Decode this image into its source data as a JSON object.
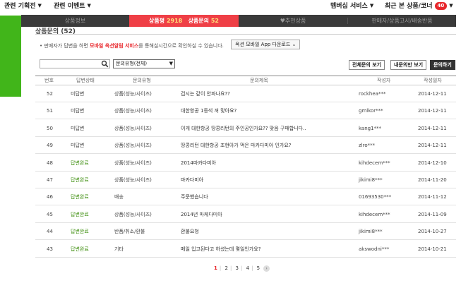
{
  "topnav": {
    "left1": "관련 기획전",
    "left2": "관련 이벤트",
    "right1": "멤버십 서비스",
    "right2": "최근 본 상품/코너",
    "recent_count": "40"
  },
  "tabs": [
    {
      "label": "상품정보"
    },
    {
      "label_review": "상품평",
      "review_count": "2918",
      "label_inquiry": "상품문의",
      "inquiry_count": "52"
    },
    {
      "label": "♥추천상품"
    },
    {
      "label": "판매자/상품고시/배송반품"
    }
  ],
  "section": {
    "title": "상품문의 (52)"
  },
  "notice": {
    "pre": "• 판매자가 답변을 하면 ",
    "highlight": "모바일 옥션알림 서비스",
    "post": "를 통해실시간으로 확인하실 수 있습니다."
  },
  "download_button": "옥션 모바일 App 다운로드",
  "filter": {
    "search_value": "",
    "select_value": "문의유형(전체)"
  },
  "buttons": {
    "all": "전체문의 보기",
    "mine": "내문의만 보기",
    "ask": "문의하기"
  },
  "columns": {
    "no": "번호",
    "status": "답변상태",
    "type": "문의유형",
    "title": "문의제목",
    "author": "작성자",
    "date": "작성일자"
  },
  "rows": [
    {
      "no": "52",
      "status": "미답변",
      "done": false,
      "type": "상품(성능/사이즈)",
      "title": "겁시는 같이 안파나요??",
      "author": "rockhea***",
      "date": "2014-12-11"
    },
    {
      "no": "51",
      "status": "미답변",
      "done": false,
      "type": "상품(성능/사이즈)",
      "title": "대한항공 1등석 꺼 맞아요?",
      "author": "gmlkor***",
      "date": "2014-12-11"
    },
    {
      "no": "50",
      "status": "미답변",
      "done": false,
      "type": "상품(성능/사이즈)",
      "title": "이게 대한항공 땅콩리턴의 주인공인가요?? 맞음 구매합니다..",
      "author": "kang1***",
      "date": "2014-12-11"
    },
    {
      "no": "49",
      "status": "미답변",
      "done": false,
      "type": "상품(성능/사이즈)",
      "title": "땅콩리턴 대한항공 조현아가 먹은 마카다미아 인가요?",
      "author": "zlro***",
      "date": "2014-12-11"
    },
    {
      "no": "48",
      "status": "답변완료",
      "done": true,
      "type": "상품(성능/사이즈)",
      "title": "2014마카다미아",
      "author": "kihdecem***",
      "date": "2014-12-10"
    },
    {
      "no": "47",
      "status": "답변완료",
      "done": true,
      "type": "상품(성능/사이즈)",
      "title": "마카다미아",
      "author": "jikimi8***",
      "date": "2014-11-20"
    },
    {
      "no": "46",
      "status": "답변완료",
      "done": true,
      "type": "배송",
      "title": "주문했습니다",
      "author": "01693530***",
      "date": "2014-11-12"
    },
    {
      "no": "45",
      "status": "답변완료",
      "done": true,
      "type": "상품(성능/사이즈)",
      "title": "2014년 마케다미아",
      "author": "kihdecem***",
      "date": "2014-11-09"
    },
    {
      "no": "44",
      "status": "답변완료",
      "done": true,
      "type": "반품/취소/환불",
      "title": "환불요청",
      "author": "jikimi8***",
      "date": "2014-10-27"
    },
    {
      "no": "43",
      "status": "답변완료",
      "done": true,
      "type": "기타",
      "title": "메일 입고된다고 하셨는데 몇일인가요?",
      "author": "akswodni***",
      "date": "2014-10-21"
    }
  ],
  "pagination": {
    "pages": [
      "1",
      "2",
      "3",
      "4",
      "5"
    ],
    "current": "1"
  },
  "colors": {
    "accent_red": "#ef3f46",
    "answered_green": "#3f8f10",
    "tabbar_dark": "#3a3a3a",
    "sidebar_green": "#41b51a"
  }
}
